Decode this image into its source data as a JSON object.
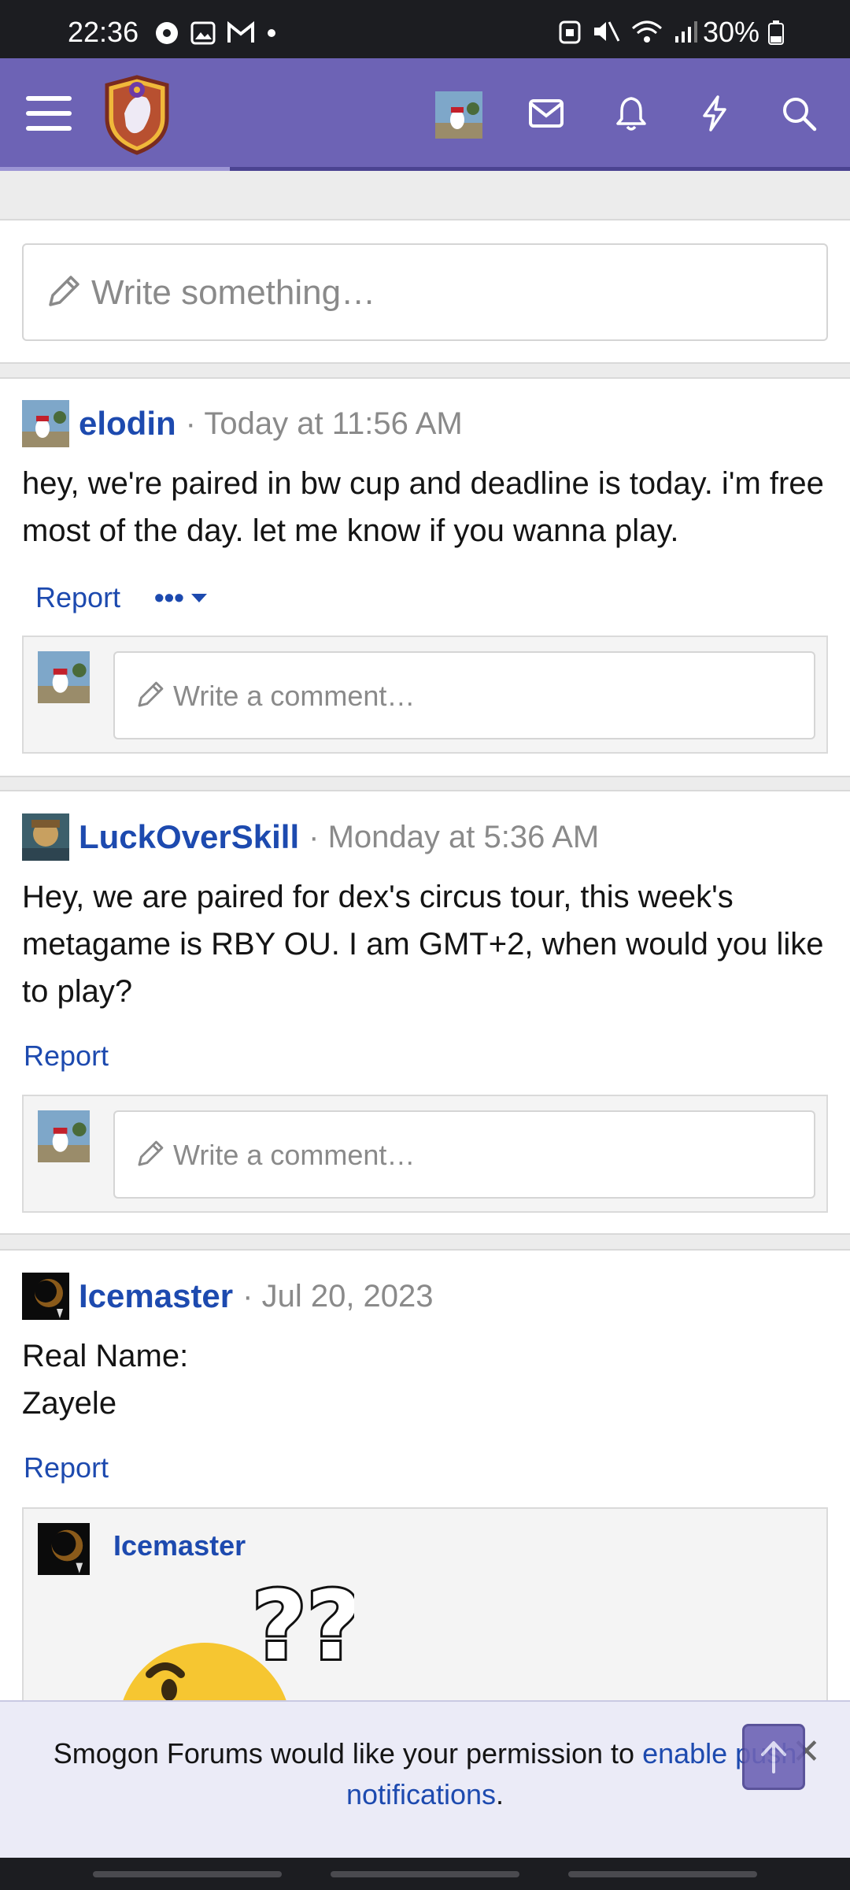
{
  "status_bar": {
    "time": "22:36",
    "battery": "30%"
  },
  "header": {
    "menu_icon": "hamburger-icon",
    "site_logo": "smogon-logo",
    "icons": [
      "inbox-icon",
      "bell-icon",
      "lightning-icon",
      "search-icon"
    ]
  },
  "composer": {
    "placeholder": "Write something…"
  },
  "posts": [
    {
      "author": "elodin",
      "time": "· Today at 11:56 AM",
      "body": "hey, we're paired in bw cup and deadline is today. i'm free most of the day. let me know if you wanna play.",
      "report": "Report",
      "more": "•••",
      "comment_placeholder": "Write a comment…"
    },
    {
      "author": "LuckOverSkill",
      "time": "· Monday at 5:36 AM",
      "body": "Hey, we are paired for dex's circus tour, this week's metagame is RBY OU. I am GMT+2, when would you like to play?",
      "report": "Report",
      "comment_placeholder": "Write a comment…"
    },
    {
      "author": "Icemaster",
      "time": "· Jul 20, 2023",
      "body_line1": "Real Name:",
      "body_line2": "Zayele",
      "report": "Report",
      "reply_author": "Icemaster",
      "reply_image": "confused-emoji",
      "reply_image_text": "??"
    }
  ],
  "notification": {
    "text_before": "Smogon Forums would like your permission to ",
    "link": "enable push notifications",
    "text_after": ".",
    "close": "✕"
  },
  "colors": {
    "header": "#6d63b5",
    "link": "#1d4aaf"
  }
}
